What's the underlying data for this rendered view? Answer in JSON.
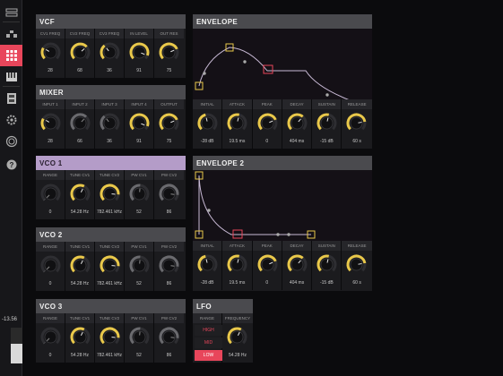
{
  "colors": {
    "accent": "#e8465b",
    "knob_active": "#e9c84a",
    "knob_inactive": "#6a6a6e",
    "vco1_header": "#b49cc8",
    "panel_bg": "#1b1b1e"
  },
  "sidebar": {
    "items": [
      {
        "icon": "rack-icon",
        "active": false
      },
      {
        "icon": "module-icon",
        "active": false
      },
      {
        "icon": "grid-icon",
        "active": true
      },
      {
        "icon": "keyboard-icon",
        "active": false
      },
      {
        "icon": "device-icon",
        "active": false
      },
      {
        "icon": "gear-icon",
        "active": false
      },
      {
        "icon": "circle-icon",
        "active": false
      },
      {
        "icon": "help-icon",
        "active": false
      }
    ],
    "readout": "-13.56",
    "meter_level": 0.55
  },
  "vcf": {
    "title": "VCF",
    "controls": [
      {
        "label": "CV1 FREQ",
        "value": "28",
        "level": 0.28,
        "active": true
      },
      {
        "label": "CV2 FREQ",
        "value": "68",
        "level": 0.68,
        "active": true
      },
      {
        "label": "CV3 FREQ",
        "value": "36",
        "level": 0.36,
        "active": true
      },
      {
        "label": "IN LEVEL",
        "value": "91",
        "level": 0.91,
        "active": true
      },
      {
        "label": "OUT RES",
        "value": "75",
        "level": 0.75,
        "active": true
      }
    ]
  },
  "mixer": {
    "title": "MIXER",
    "controls": [
      {
        "label": "INPUT 1",
        "value": "28",
        "level": 0.28,
        "active": true
      },
      {
        "label": "INPUT 2",
        "value": "66",
        "level": 0.66,
        "active": false
      },
      {
        "label": "INPUT 3",
        "value": "36",
        "level": 0.36,
        "active": false
      },
      {
        "label": "INPUT 4",
        "value": "91",
        "level": 0.91,
        "active": true
      },
      {
        "label": "OUTPUT",
        "value": "75",
        "level": 0.75,
        "active": true
      }
    ]
  },
  "vco1": {
    "title": "VCO 1",
    "controls": [
      {
        "label": "RANGE",
        "value": "0",
        "level": 0.0,
        "active": false
      },
      {
        "label": "TUNE CV1",
        "value": "54.28 Hz",
        "level": 0.6,
        "active": true
      },
      {
        "label": "TUNE CV2",
        "value": "782.461 kHz",
        "level": 0.85,
        "active": true
      },
      {
        "label": "PW CV1",
        "value": "52",
        "level": 0.52,
        "active": false
      },
      {
        "label": "PW CV2",
        "value": "86",
        "level": 0.86,
        "active": false
      }
    ]
  },
  "vco2": {
    "title": "VCO 2",
    "controls": [
      {
        "label": "RANGE",
        "value": "0",
        "level": 0.0,
        "active": false
      },
      {
        "label": "TUNE CV1",
        "value": "54.28 Hz",
        "level": 0.6,
        "active": true
      },
      {
        "label": "TUNE CV2",
        "value": "782.461 kHz",
        "level": 0.85,
        "active": true
      },
      {
        "label": "PW CV1",
        "value": "52",
        "level": 0.52,
        "active": false
      },
      {
        "label": "PW CV2",
        "value": "86",
        "level": 0.86,
        "active": false
      }
    ]
  },
  "vco3": {
    "title": "VCO 3",
    "controls": [
      {
        "label": "RANGE",
        "value": "0",
        "level": 0.0,
        "active": false
      },
      {
        "label": "TUNE CV1",
        "value": "54.28 Hz",
        "level": 0.6,
        "active": true
      },
      {
        "label": "TUNE CV2",
        "value": "782.461 kHz",
        "level": 0.85,
        "active": true
      },
      {
        "label": "PW CV1",
        "value": "52",
        "level": 0.52,
        "active": false
      },
      {
        "label": "PW CV2",
        "value": "86",
        "level": 0.86,
        "active": false
      }
    ]
  },
  "envelope1": {
    "title": "ENVELOPE",
    "controls": [
      {
        "label": "INITIAL",
        "value": "-28 dB",
        "level": 0.45,
        "active": true
      },
      {
        "label": "ATTACK",
        "value": "19.5 ms",
        "level": 0.55,
        "active": true
      },
      {
        "label": "PEAK",
        "value": "0",
        "level": 0.75,
        "active": true
      },
      {
        "label": "DECAY",
        "value": "404 ms",
        "level": 0.65,
        "active": true
      },
      {
        "label": "SUSTAIN",
        "value": "-15 dB",
        "level": 0.55,
        "active": true
      },
      {
        "label": "RELEASE",
        "value": "60 s",
        "level": 0.8,
        "active": true
      }
    ]
  },
  "envelope2": {
    "title": "ENVELOPE 2",
    "controls": [
      {
        "label": "INITIAL",
        "value": "-28 dB",
        "level": 0.45,
        "active": true
      },
      {
        "label": "ATTACK",
        "value": "19.5 ms",
        "level": 0.55,
        "active": true
      },
      {
        "label": "PEAK",
        "value": "0",
        "level": 0.75,
        "active": true
      },
      {
        "label": "DECAY",
        "value": "404 ms",
        "level": 0.65,
        "active": true
      },
      {
        "label": "SUSTAIN",
        "value": "-15 dB",
        "level": 0.55,
        "active": true
      },
      {
        "label": "RELEASE",
        "value": "60 s",
        "level": 0.8,
        "active": true
      }
    ]
  },
  "lfo": {
    "title": "LFO",
    "range_label": "RANGE",
    "range_options": [
      "HIGH",
      "MID",
      "LOW"
    ],
    "range_selected": "LOW",
    "frequency": {
      "label": "FREQUENCY",
      "value": "54.28 Hz",
      "level": 0.6,
      "active": true
    }
  }
}
